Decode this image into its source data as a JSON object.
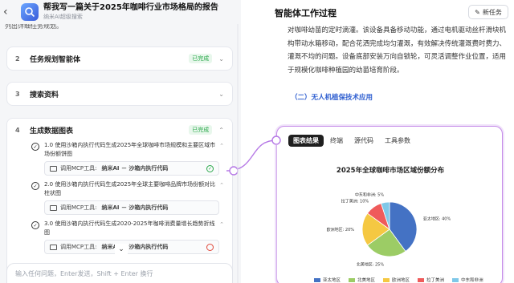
{
  "header": {
    "back_icon": "chevron-left-icon",
    "title": "帮我写一篇关于2025年咖啡行业市场格局的报告",
    "subtitle": "纳米AI超级搜索",
    "cut_line": "列出详细任务规划。"
  },
  "steps": [
    {
      "num": "2",
      "title": "任务规划智能体",
      "status": "已完成"
    },
    {
      "num": "3",
      "title": "搜索资料",
      "status": ""
    },
    {
      "num": "4",
      "title": "生成数据图表",
      "status": "已完成"
    }
  ],
  "sub_items": [
    {
      "text": "1.0 使用沙箱内执行代码生成2025年全球咖啡市场规模和主要区域市场份额饼图",
      "tool_prefix": "调用MCP工具:",
      "tool_name": "纳米AI － 沙箱内执行代码",
      "tool_status": "ok"
    },
    {
      "text": "2.0 使用沙箱内执行代码生成2025年全球主要咖啡品牌市场份额对比柱状图",
      "tool_prefix": "调用MCP工具:",
      "tool_name": "纳米AI － 沙箱内执行代码",
      "tool_status": "none"
    },
    {
      "text": "3.0 使用沙箱内执行代码生成2020-2025年咖啡消费量增长趋势折线图",
      "tool_prefix": "调用MCP工具:",
      "tool_name": "纳米AI － 沙箱内执行代码",
      "tool_status": "error"
    }
  ],
  "input": {
    "placeholder": "输入任何问题，Enter发送，Shift + Enter 换行"
  },
  "right": {
    "title": "智能体工作过程",
    "new_task": "新任务",
    "paragraph": "对咖啡幼苗的定时滴灌。该设备具备移动功能，通过电机驱动丝杆滑块机构带动水箱移动，配合花洒完成均匀灌溉，有效解决传统灌溉费时费力、灌溉不均的问题。设备底部安装万向自锁轮，可灵活调整作业位置，适用于规模化咖啡种植园的幼苗培育阶段。",
    "section": "（二）无人机植保技术应用",
    "tabs": [
      "图表结果",
      "终端",
      "源代码",
      "工具参数"
    ]
  },
  "chart_data": {
    "type": "pie",
    "title": "2025年全球咖啡市场区域份额分布",
    "labels": [
      "亚太地区",
      "北美地区",
      "欧洲地区",
      "拉丁美洲",
      "中东和非洲"
    ],
    "values": [
      40,
      25,
      20,
      10,
      5
    ],
    "slice_labels": [
      "亚太地区: 40%",
      "北美地区: 25%",
      "欧洲地区: 20%",
      "拉丁美洲: 10%",
      "中东和非洲: 5%"
    ],
    "colors": [
      "#4472c4",
      "#9ccc65",
      "#f5c842",
      "#ef5b5b",
      "#7fc8e8"
    ],
    "legend": "bottom"
  }
}
